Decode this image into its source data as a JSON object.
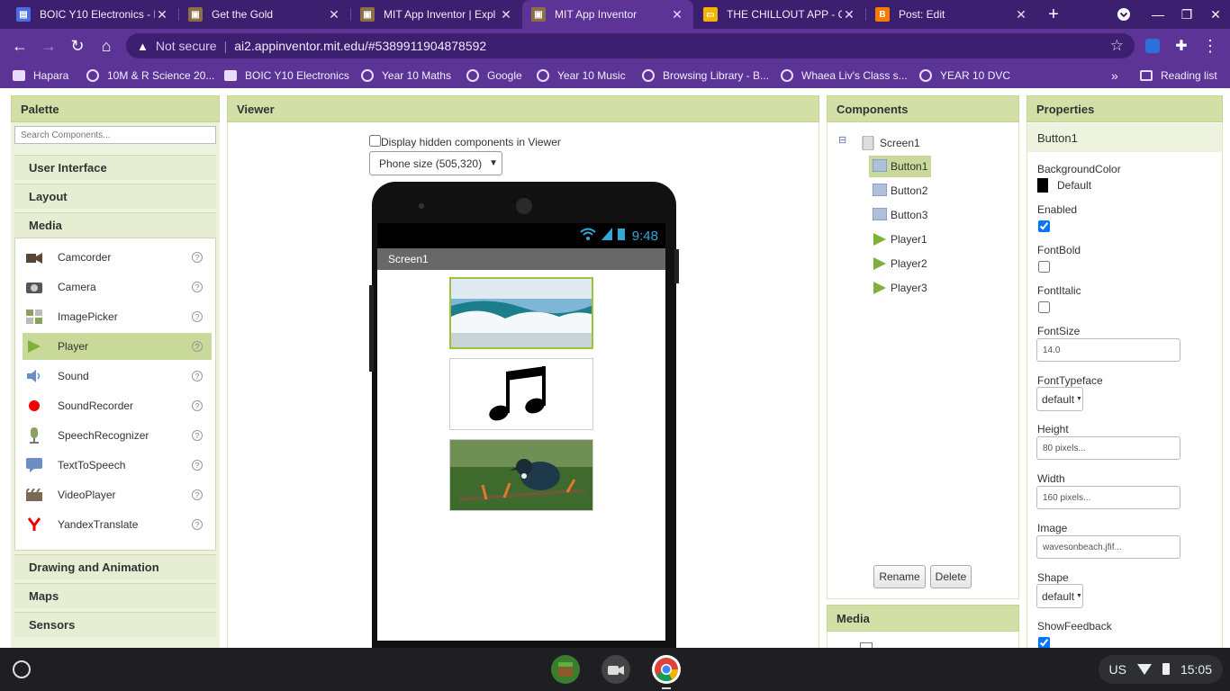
{
  "browser": {
    "tabs": [
      {
        "title": "BOIC Y10 Electronics - F",
        "favicon": "google-sites-icon",
        "color": "#4a6ee0"
      },
      {
        "title": "Get the Gold",
        "favicon": "app-inventor-icon",
        "color": "#8b6f47"
      },
      {
        "title": "MIT App Inventor | Expl",
        "favicon": "app-inventor-icon",
        "color": "#8b6f47"
      },
      {
        "title": "MIT App Inventor",
        "favicon": "app-inventor-icon",
        "color": "#8b6f47",
        "active": true
      },
      {
        "title": "THE CHILLOUT APP - G",
        "favicon": "google-slides-icon",
        "color": "#f4b400"
      },
      {
        "title": "Post: Edit",
        "favicon": "blogger-icon",
        "color": "#f57d00"
      }
    ],
    "security_label": "Not secure",
    "url": "ai2.appinventor.mit.edu/#5389911904878592",
    "bookmarks": [
      {
        "label": "Hapara",
        "icon": "hapara-icon"
      },
      {
        "label": "10M & R Science 20...",
        "icon": "globe-icon"
      },
      {
        "label": "BOIC Y10 Electronics",
        "icon": "google-sites-icon"
      },
      {
        "label": "Year 10 Maths",
        "icon": "globe-icon"
      },
      {
        "label": "Google",
        "icon": "globe-icon"
      },
      {
        "label": "Year 10 Music",
        "icon": "globe-icon"
      },
      {
        "label": "Browsing Library - B...",
        "icon": "globe-icon"
      },
      {
        "label": "Whaea Liv's Class s...",
        "icon": "globe-icon"
      },
      {
        "label": "YEAR 10 DVC",
        "icon": "globe-icon"
      }
    ],
    "overflow_label": "»",
    "reading_list": "Reading list"
  },
  "palette": {
    "title": "Palette",
    "search_placeholder": "Search Components...",
    "categories_top": [
      "User Interface",
      "Layout",
      "Media"
    ],
    "media_items": [
      {
        "label": "Camcorder",
        "icon": "camcorder-icon"
      },
      {
        "label": "Camera",
        "icon": "camera-icon"
      },
      {
        "label": "ImagePicker",
        "icon": "image-picker-icon"
      },
      {
        "label": "Player",
        "icon": "player-icon",
        "selected": true
      },
      {
        "label": "Sound",
        "icon": "sound-icon"
      },
      {
        "label": "SoundRecorder",
        "icon": "sound-recorder-icon"
      },
      {
        "label": "SpeechRecognizer",
        "icon": "speech-recognizer-icon"
      },
      {
        "label": "TextToSpeech",
        "icon": "text-to-speech-icon"
      },
      {
        "label": "VideoPlayer",
        "icon": "video-player-icon"
      },
      {
        "label": "YandexTranslate",
        "icon": "yandex-translate-icon"
      }
    ],
    "help_glyph": "?",
    "categories_bottom": [
      "Drawing and Animation",
      "Maps",
      "Sensors"
    ]
  },
  "viewer": {
    "title": "Viewer",
    "hidden_components_label": "Display hidden components in Viewer",
    "size_select": "Phone size (505,320)",
    "status_time": "9:48",
    "screen_title": "Screen1"
  },
  "components": {
    "title": "Components",
    "root": "Screen1",
    "collapse_glyph": "⊟",
    "items": [
      "Button1",
      "Button2",
      "Button3",
      "Player1",
      "Player2",
      "Player3"
    ],
    "selected": "Button1",
    "rename_label": "Rename",
    "delete_label": "Delete",
    "media_title": "Media"
  },
  "properties": {
    "title": "Properties",
    "component": "Button1",
    "background_color_label": "BackgroundColor",
    "background_color_value": "Default",
    "enabled_label": "Enabled",
    "font_bold_label": "FontBold",
    "font_italic_label": "FontItalic",
    "font_size_label": "FontSize",
    "font_size_value": "14.0",
    "font_typeface_label": "FontTypeface",
    "font_typeface_value": "default",
    "height_label": "Height",
    "height_value": "80 pixels...",
    "width_label": "Width",
    "width_value": "160 pixels...",
    "image_label": "Image",
    "image_value": "wavesonbeach.jfif...",
    "shape_label": "Shape",
    "shape_value": "default",
    "show_feedback_label": "ShowFeedback"
  },
  "shelf": {
    "locale": "US",
    "time": "15:05"
  },
  "colors": {
    "accent": "#5b3496",
    "palette_header": "#d2e0a8",
    "selection": "#c8d99a"
  }
}
